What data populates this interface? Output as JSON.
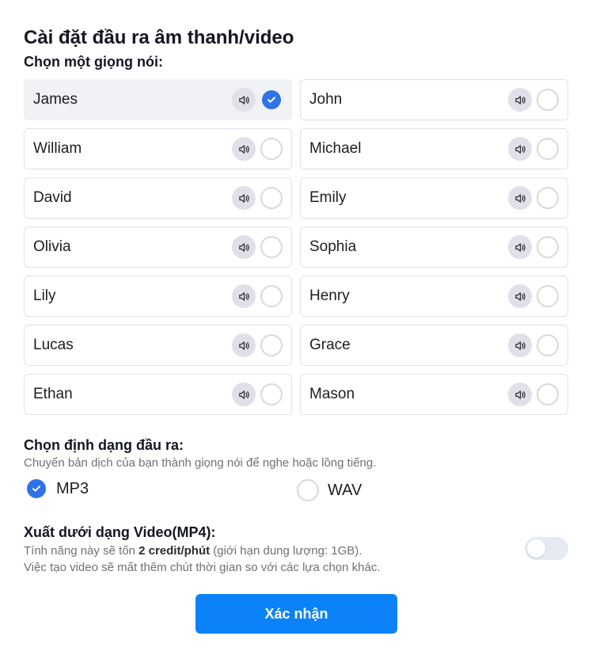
{
  "dialog": {
    "title": "Cài đặt đầu ra âm thanh/video"
  },
  "voices": {
    "heading": "Chọn một giọng nói:",
    "selected": "James",
    "items": [
      {
        "name": "James",
        "selected": true
      },
      {
        "name": "John",
        "selected": false
      },
      {
        "name": "William",
        "selected": false
      },
      {
        "name": "Michael",
        "selected": false
      },
      {
        "name": "David",
        "selected": false
      },
      {
        "name": "Emily",
        "selected": false
      },
      {
        "name": "Olivia",
        "selected": false
      },
      {
        "name": "Sophia",
        "selected": false
      },
      {
        "name": "Lily",
        "selected": false
      },
      {
        "name": "Henry",
        "selected": false
      },
      {
        "name": "Lucas",
        "selected": false
      },
      {
        "name": "Grace",
        "selected": false
      },
      {
        "name": "Ethan",
        "selected": false
      },
      {
        "name": "Mason",
        "selected": false
      }
    ],
    "preview_icon": "speaker-icon"
  },
  "format": {
    "heading": "Chọn định dạng đầu ra:",
    "description": "Chuyển bản dịch của bạn thành giọng nói để nghe hoặc lồng tiếng.",
    "options": [
      {
        "label": "MP3",
        "selected": true
      },
      {
        "label": "WAV",
        "selected": false
      }
    ]
  },
  "video": {
    "heading": "Xuất dưới dạng Video(MP4):",
    "desc_line1_prefix": "Tính năng này sẽ tốn ",
    "desc_line1_bold": "2 credit/phút",
    "desc_line1_suffix": " (giới hạn dung lượng: 1GB).",
    "desc_line2": "Việc tạo video sẽ mất thêm chút thời gian so với các lựa chọn khác.",
    "enabled": false
  },
  "actions": {
    "confirm_label": "Xác nhận"
  },
  "colors": {
    "accent": "#2f73e6",
    "button": "#0b82f7",
    "selected_card": "#f1f2f6",
    "toggle_off": "#e5eaf3"
  }
}
